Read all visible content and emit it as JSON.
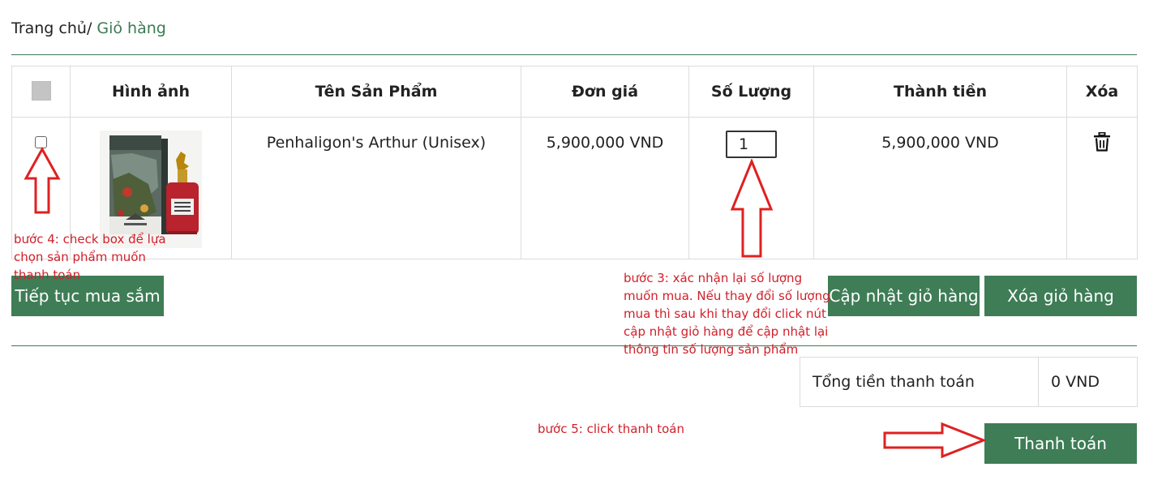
{
  "breadcrumb": {
    "home": "Trang chủ/",
    "current": " Giỏ hàng"
  },
  "table": {
    "headers": {
      "image": "Hình ảnh",
      "name": "Tên Sản Phẩm",
      "price": "Đơn giá",
      "quantity": "Số Lượng",
      "total": "Thành tiền",
      "delete": "Xóa"
    },
    "rows": [
      {
        "name": "Penhaligon's Arthur (Unisex)",
        "price": "5,900,000 VND",
        "quantity": "1",
        "total": "5,900,000 VND"
      }
    ]
  },
  "buttons": {
    "continue_shopping": "Tiếp tục mua sắm",
    "update_cart": "Cập nhật giỏ hàng",
    "clear_cart": "Xóa giỏ hàng",
    "checkout": "Thanh toán"
  },
  "summary": {
    "label": "Tổng tiền thanh toán",
    "value": "0 VND"
  },
  "annotations": {
    "step3": "bước 3: xác nhận lại số lượng muốn mua. Nếu thay đổi số lượng mua thì sau khi thay đổi click nút cập nhật giỏ hàng để cập nhật lại thông tin số lượng sản phẩm",
    "step4": "bước 4: check box để lựa chọn sản phẩm muốn thanh toán",
    "step5": "bước 5: click thanh toán"
  },
  "colors": {
    "accent": "#3e7d56",
    "annotation": "#d0202a",
    "arrow": "#e02020"
  },
  "icons": {
    "delete": "trash-icon"
  }
}
